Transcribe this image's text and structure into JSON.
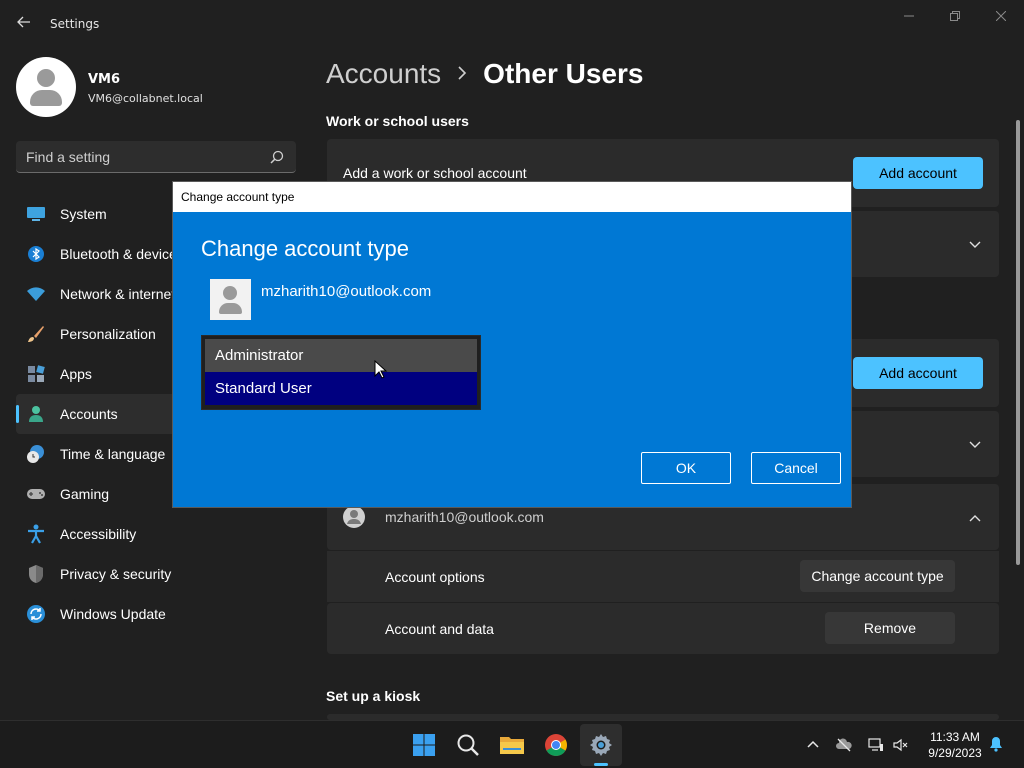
{
  "window": {
    "app_title": "Settings"
  },
  "profile": {
    "name": "VM6",
    "email": "VM6@collabnet.local"
  },
  "search": {
    "placeholder": "Find a setting"
  },
  "sidebar": {
    "items": [
      {
        "label": "System",
        "icon": "monitor-icon"
      },
      {
        "label": "Bluetooth & devices",
        "icon": "bluetooth-icon"
      },
      {
        "label": "Network & internet",
        "icon": "wifi-icon"
      },
      {
        "label": "Personalization",
        "icon": "paintbrush-icon"
      },
      {
        "label": "Apps",
        "icon": "apps-icon"
      },
      {
        "label": "Accounts",
        "icon": "person-icon",
        "active": true
      },
      {
        "label": "Time & language",
        "icon": "clock-globe-icon"
      },
      {
        "label": "Gaming",
        "icon": "gamepad-icon"
      },
      {
        "label": "Accessibility",
        "icon": "accessibility-icon"
      },
      {
        "label": "Privacy & security",
        "icon": "shield-icon"
      },
      {
        "label": "Windows Update",
        "icon": "update-icon"
      }
    ]
  },
  "main": {
    "breadcrumb_parent": "Accounts",
    "breadcrumb_current": "Other Users",
    "work_section_title": "Work or school users",
    "add_work_label": "Add a work or school account",
    "add_account_label": "Add account",
    "user_email": "mzharith10@outlook.com",
    "account_options_label": "Account options",
    "change_account_type_label": "Change account type",
    "account_data_label": "Account and data",
    "remove_label": "Remove",
    "kiosk_section_title": "Set up a kiosk"
  },
  "dialog": {
    "window_title": "Change account type",
    "heading": "Change account type",
    "user_email": "mzharith10@outlook.com",
    "options": [
      "Administrator",
      "Standard User"
    ],
    "selected_option": "Standard User",
    "ok_label": "OK",
    "cancel_label": "Cancel"
  },
  "taskbar": {
    "apps": [
      "windows-start-icon",
      "search-icon",
      "file-explorer-icon",
      "chrome-icon",
      "settings-gear-icon"
    ],
    "time": "11:33 AM",
    "date": "9/29/2023"
  },
  "colors": {
    "accent": "#4cc2ff",
    "dialog_blue": "#0078d4",
    "selected_navy": "#000080",
    "background": "#202020",
    "card": "#2b2b2b"
  }
}
